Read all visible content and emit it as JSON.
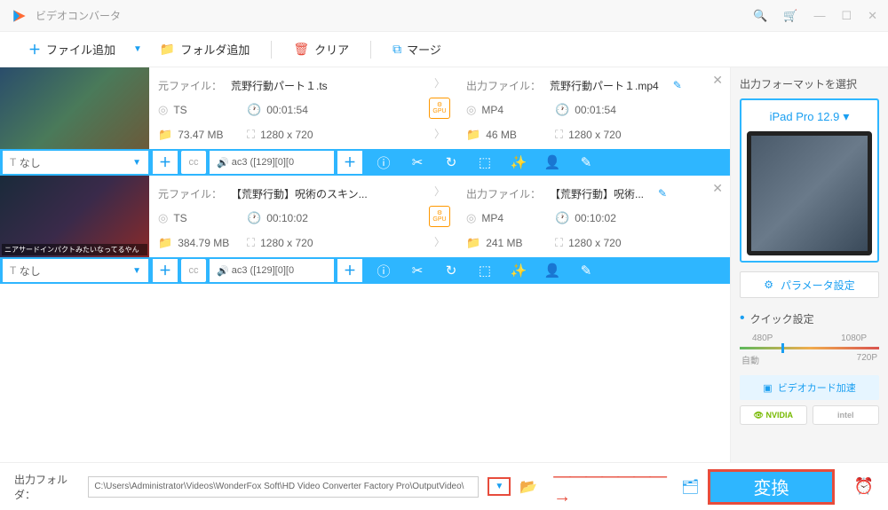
{
  "titlebar": {
    "title": "ビデオコンバータ"
  },
  "toolbar": {
    "add_file": "ファイル追加",
    "add_folder": "フォルダ追加",
    "clear": "クリア",
    "merge": "マージ"
  },
  "items": [
    {
      "src_label": "元ファイル：",
      "src_name": "荒野行動パート１.ts",
      "out_label": "出力ファイル：",
      "out_name": "荒野行動パート１.mp4",
      "src_format": "TS",
      "src_duration": "00:01:54",
      "src_size": "73.47 MB",
      "src_res": "1280 x 720",
      "out_format": "MP4",
      "out_duration": "00:01:54",
      "out_size": "46 MB",
      "out_res": "1280 x 720",
      "subtitle": "なし",
      "audio": "ac3 ([129][0][0",
      "gpu": "GPU"
    },
    {
      "src_label": "元ファイル：",
      "src_name": "【荒野行動】呪術のスキン...",
      "out_label": "出力ファイル：",
      "out_name": "【荒野行動】呪術...",
      "src_format": "TS",
      "src_duration": "00:10:02",
      "src_size": "384.79 MB",
      "src_res": "1280 x 720",
      "out_format": "MP4",
      "out_duration": "00:10:02",
      "out_size": "241 MB",
      "out_res": "1280 x 720",
      "subtitle": "なし",
      "audio": "ac3 ([129][0][0",
      "gpu": "GPU",
      "thumb_caption": "ニアサードインパクトみたいなってるやん"
    }
  ],
  "right": {
    "section_title": "出力フォーマットを選択",
    "format_name": "iPad Pro 12.9",
    "param_btn": "パラメータ設定",
    "quick_title": "クイック設定",
    "q_480p": "480P",
    "q_1080p": "1080P",
    "q_auto": "自動",
    "q_720p": "720P",
    "gpu_accel": "ビデオカード加速",
    "nvidia": "NVIDIA",
    "intel": "intel"
  },
  "footer": {
    "label": "出力フォルダ：",
    "path": "C:\\Users\\Administrator\\Videos\\WonderFox Soft\\HD Video Converter Factory Pro\\OutputVideo\\",
    "convert": "変換"
  }
}
